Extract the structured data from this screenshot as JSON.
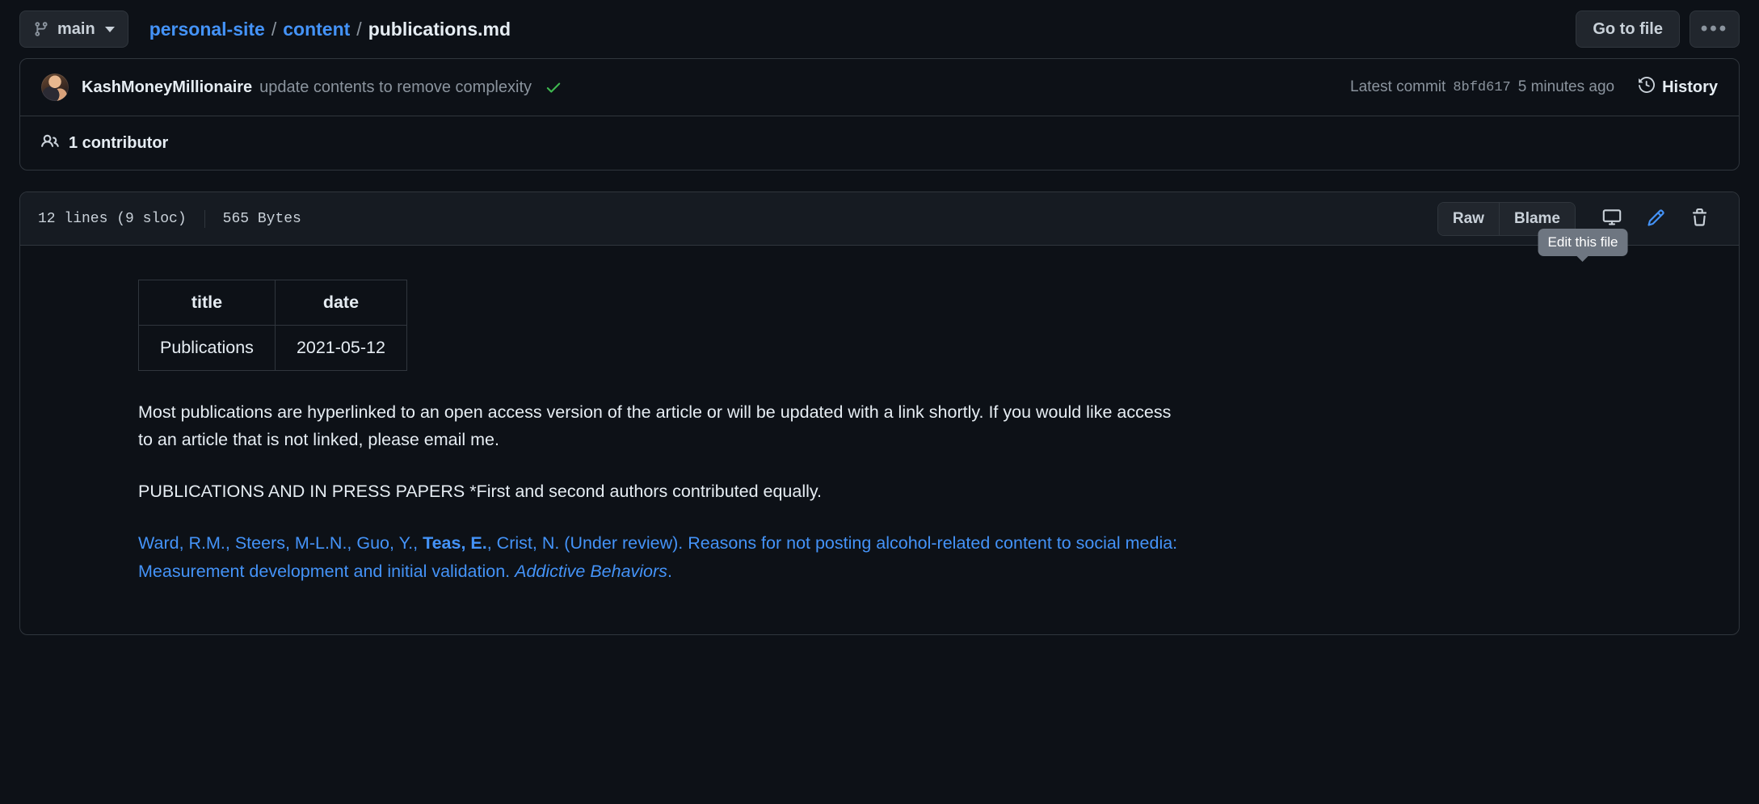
{
  "topbar": {
    "branch": "main",
    "branch_icon": "git-branch-icon",
    "breadcrumb": {
      "repo": "personal-site",
      "folder": "content",
      "file": "publications.md",
      "separator": "/"
    },
    "go_to_file": "Go to file",
    "kebab": "•••"
  },
  "commit": {
    "author": "KashMoneyMillionaire",
    "message": "update contents to remove complexity",
    "status_icon": "check-icon",
    "latest_commit_label": "Latest commit",
    "sha": "8bfd617",
    "time_ago": "5 minutes ago",
    "history_label": "History",
    "history_icon": "history-icon",
    "contributors_count_label": "1 contributor",
    "contributors_icon": "people-icon"
  },
  "file": {
    "lines": "12 lines (9 sloc)",
    "size": "565 Bytes",
    "raw_label": "Raw",
    "blame_label": "Blame",
    "desktop_icon": "desktop-download-icon",
    "edit_icon": "pencil-icon",
    "delete_icon": "trash-icon",
    "tooltip": "Edit this file"
  },
  "content": {
    "table": {
      "headers": [
        "title",
        "date"
      ],
      "rows": [
        [
          "Publications",
          "2021-05-12"
        ]
      ]
    },
    "paragraph_1": "Most publications are hyperlinked to an open access version of the article or will be updated with a link shortly. If you would like access to an article that is not linked, please email me.",
    "paragraph_2": "PUBLICATIONS AND IN PRESS PAPERS *First and second authors contributed equally.",
    "citation": {
      "part_1": "Ward, R.M., Steers, M-L.N., Guo, Y., ",
      "bold": "Teas, E.",
      "part_2": ", Crist, N. (Under review). Reasons for not posting alcohol-related content to social media: Measurement development and initial validation. ",
      "italic": "Addictive Behaviors",
      "part_3": "."
    }
  },
  "colors": {
    "background": "#0d1117",
    "panel_border": "#30363d",
    "link": "#4493f8",
    "muted": "#8b949e",
    "text": "#e6edf3",
    "success": "#3fb950",
    "tooltip_bg": "#6e7681"
  }
}
